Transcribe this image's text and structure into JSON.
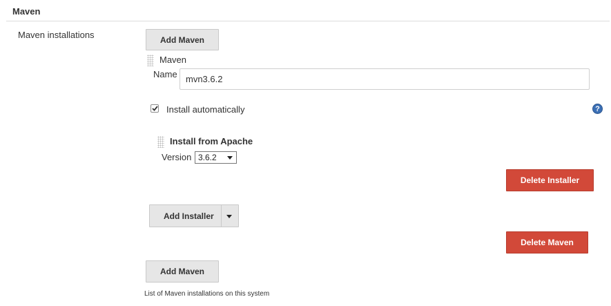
{
  "section": {
    "title": "Maven"
  },
  "field": {
    "label": "Maven installations"
  },
  "buttons": {
    "add_maven_top": "Add Maven",
    "add_maven_bottom": "Add Maven",
    "delete_installer": "Delete Installer",
    "delete_maven": "Delete Maven",
    "add_installer": "Add Installer"
  },
  "installation": {
    "header": "Maven",
    "name_label": "Name",
    "name_value": "mvn3.6.2",
    "install_auto_label": "Install automatically",
    "install_auto_checked": true,
    "help_symbol": "?"
  },
  "installer": {
    "title": "Install from Apache",
    "version_label": "Version",
    "version_selected": "3.6.2"
  },
  "footer": {
    "description": "List of Maven installations on this system"
  },
  "colors": {
    "danger": "#d24939",
    "help": "#3b6fb5",
    "button_gray": "#e6e6e6"
  },
  "icons": {
    "drag_handle": "drag-handle-icon",
    "checkmark": "checkmark-icon",
    "help": "help-icon",
    "dropdown": "chevron-down-icon"
  }
}
